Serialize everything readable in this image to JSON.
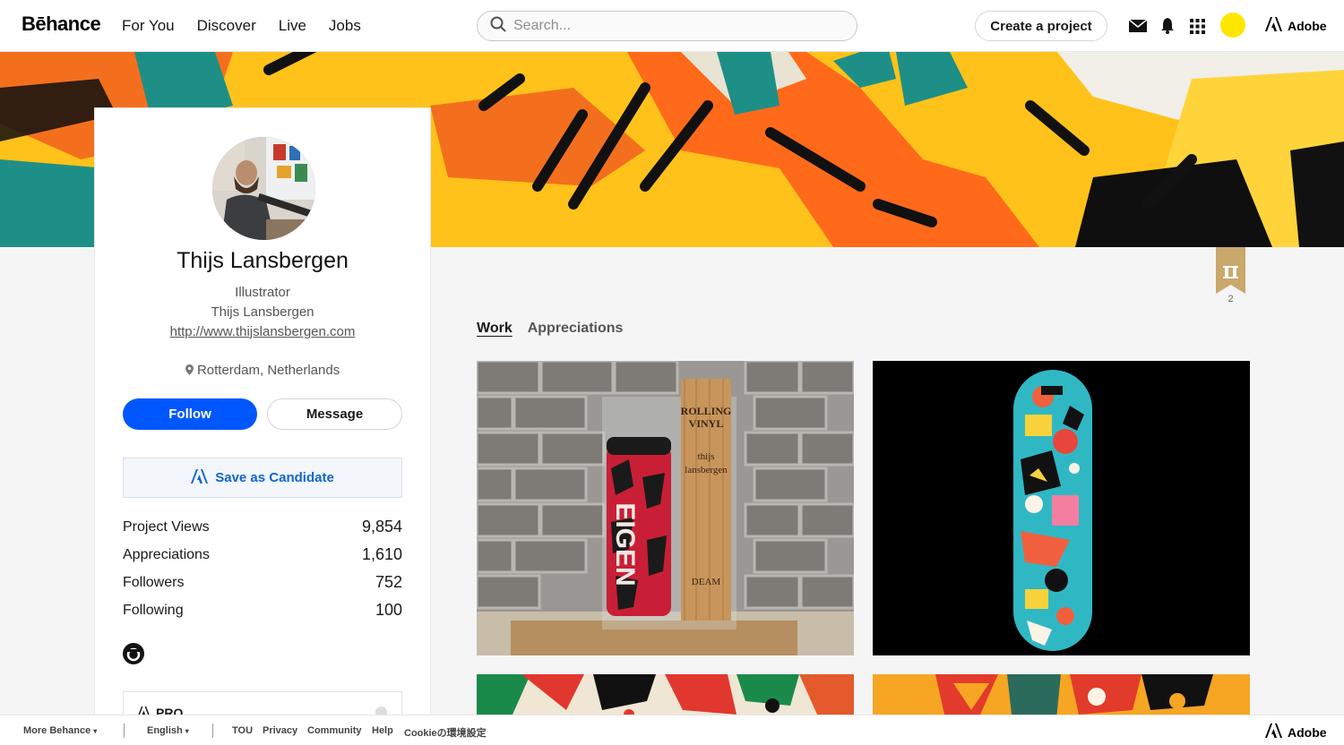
{
  "nav": {
    "logo": "Bēhance",
    "links": [
      "For You",
      "Discover",
      "Live",
      "Jobs"
    ],
    "search_placeholder": "Search...",
    "create_label": "Create a project",
    "adobe_label": "Adobe",
    "avatar_color": "#ffe600"
  },
  "profile": {
    "name": "Thijs Lansbergen",
    "occupation": "Illustrator",
    "company": "Thijs Lansbergen",
    "website": "http://www.thijslansbergen.com",
    "location": "Rotterdam, Netherlands",
    "follow_label": "Follow",
    "message_label": "Message",
    "candidate_label": "Save as Candidate",
    "stats": [
      {
        "label": "Project Views",
        "value": "9,854"
      },
      {
        "label": "Appreciations",
        "value": "1,610"
      },
      {
        "label": "Followers",
        "value": "752"
      },
      {
        "label": "Following",
        "value": "100"
      }
    ],
    "pro_label": "PRO"
  },
  "badge": {
    "count": "2"
  },
  "tabs": [
    "Work",
    "Appreciations"
  ],
  "projects": [
    {
      "name": "Rolling Vinyl spray can",
      "case_text": [
        "ROLLING",
        "VINYL",
        "thijs",
        "lansbergen",
        "DEAM"
      ],
      "can_text": "EIGEN"
    },
    {
      "name": "Illustrated skateboard deck"
    },
    {
      "name": "Illustration project 3"
    },
    {
      "name": "Illustration project 4"
    }
  ],
  "footer": {
    "more": "More Behance",
    "language": "English",
    "links": [
      "TOU",
      "Privacy",
      "Community",
      "Help",
      "Cookieの環境設定"
    ],
    "adobe_label": "Adobe"
  },
  "colors": {
    "accent": "#0057ff",
    "candidate_text": "#0d66d0",
    "badge": "#c9a86b"
  }
}
